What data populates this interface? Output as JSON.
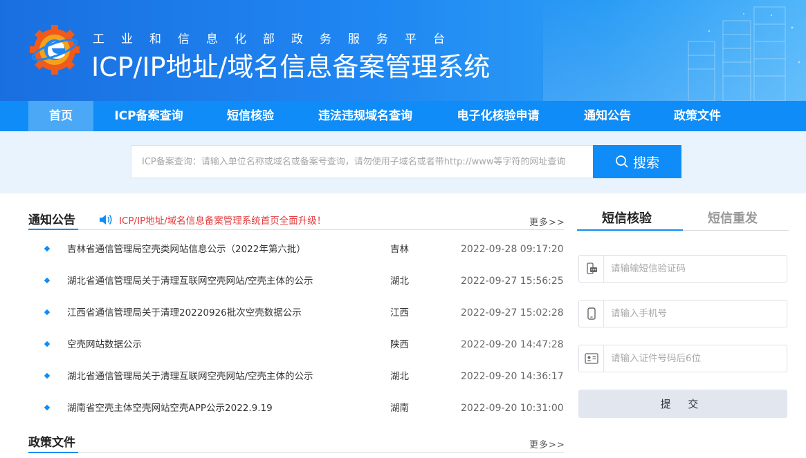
{
  "header": {
    "subtitle": "工业和信息化部政务服务平台",
    "title": "ICP/IP地址/域名信息备案管理系统"
  },
  "nav": {
    "items": [
      {
        "label": "首页"
      },
      {
        "label": "ICP备案查询"
      },
      {
        "label": "短信核验"
      },
      {
        "label": "违法违规域名查询"
      },
      {
        "label": "电子化核验申请"
      },
      {
        "label": "通知公告"
      },
      {
        "label": "政策文件"
      }
    ]
  },
  "search": {
    "placeholder": "ICP备案查询：请输入单位名称或域名或备案号查询，请勿使用子域名或者带http://www等字符的网址查询",
    "button_label": "搜索"
  },
  "notices": {
    "title": "通知公告",
    "marquee": "ICP/IP地址/域名信息备案管理系统首页全面升级！",
    "more": "更多>>",
    "items": [
      {
        "title": "吉林省通信管理局空壳类网站信息公示（2022年第六批）",
        "region": "吉林",
        "time": "2022-09-28 09:17:20"
      },
      {
        "title": "湖北省通信管理局关于清理互联网空壳网站/空壳主体的公示",
        "region": "湖北",
        "time": "2022-09-27 15:56:25"
      },
      {
        "title": "江西省通信管理局关于清理20220926批次空壳数据公示",
        "region": "江西",
        "time": "2022-09-27 15:02:28"
      },
      {
        "title": "空壳网站数据公示",
        "region": "陕西",
        "time": "2022-09-20 14:47:28"
      },
      {
        "title": "湖北省通信管理局关于清理互联网空壳网站/空壳主体的公示",
        "region": "湖北",
        "time": "2022-09-20 14:36:17"
      },
      {
        "title": "湖南省空壳主体空壳网站空壳APP公示2022.9.19",
        "region": "湖南",
        "time": "2022-09-20 10:31:00"
      }
    ]
  },
  "policy": {
    "title": "政策文件",
    "more": "更多>>"
  },
  "sms": {
    "tab_verify": "短信核验",
    "tab_resend": "短信重发",
    "code_placeholder": "请输输短信验证码",
    "phone_placeholder": "请输入手机号",
    "id_placeholder": "请输入证件号码后6位",
    "submit_label": "提 交"
  },
  "colors": {
    "primary": "#0f8cf7",
    "nav_active": "#4aa8f7",
    "alert": "#e53a3a",
    "search_band": "#e9f3fd"
  }
}
